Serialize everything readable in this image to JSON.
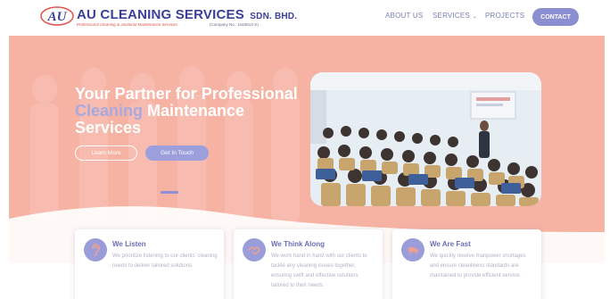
{
  "header": {
    "logo_initials": "AU",
    "brand_name": "AU CLEANING SERVICES",
    "brand_suffix": "SDN. BHD.",
    "tagline": "Professional Cleaning & Janitorial Maintenance Services",
    "company_no": "(Company No.: 1163613-X)",
    "nav": {
      "about": "ABOUT US",
      "services": "SERVICES",
      "projects": "PROJECTS",
      "contact": "CONTACT"
    }
  },
  "hero": {
    "title_line1": "Your Partner for Professional",
    "title_highlight": "Cleaning",
    "title_line2_rest": " Maintenance",
    "title_line3": "Services",
    "learn_more": "Learn More",
    "get_in_touch": "Get In Touch"
  },
  "features": [
    {
      "title": "We Listen",
      "description": "We prioritize listening to our clients' cleaning needs to deliver tailored solutions.",
      "icon": "ear-icon"
    },
    {
      "title": "We Think Along",
      "description": "We work hand in hand with our clients to tackle any cleaning issues together, ensuring swift and effective solutions tailored to their needs.",
      "icon": "handshake-icon"
    },
    {
      "title": "We Are Fast",
      "description": "We quickly resolve manpower shortages and ensure cleanliness standards are maintained to provide efficient service.",
      "icon": "fast-truck-icon"
    }
  ],
  "colors": {
    "brand_blue": "#3a3f9a",
    "accent_purple": "#8c8ed2",
    "hero_salmon": "#f6b3a4",
    "tagline_red": "#e0524a"
  }
}
